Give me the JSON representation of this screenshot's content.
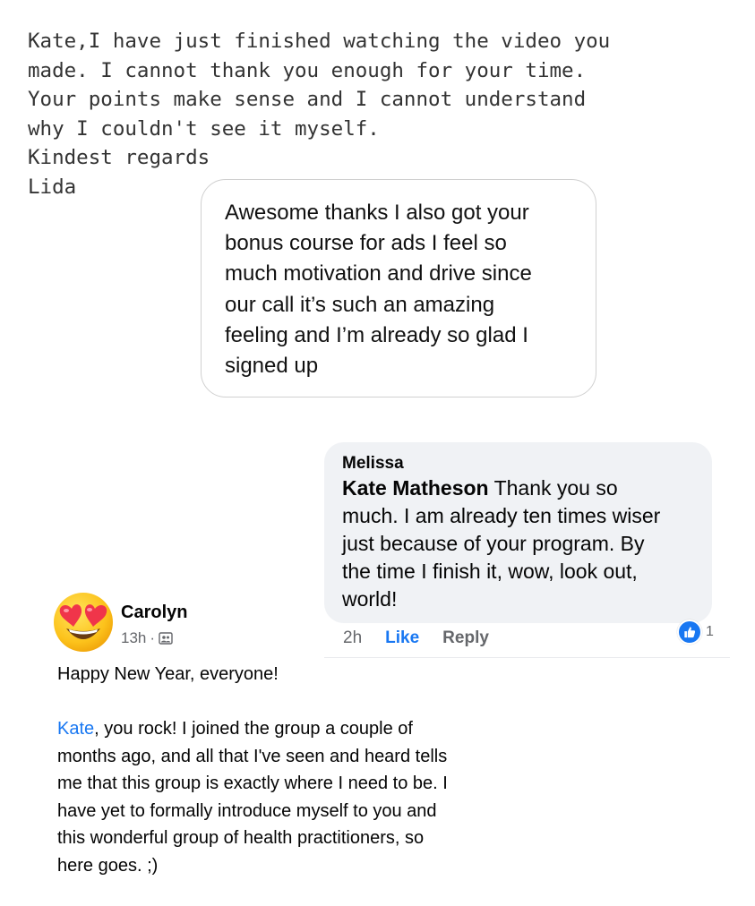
{
  "email": {
    "lines": [
      "Kate,I have just finished watching the video you",
      "made. I cannot thank you enough for your time.",
      "Your points make sense and I cannot understand",
      "why I couldn't see it myself.",
      "Kindest regards",
      "Lida"
    ]
  },
  "bubble": {
    "lines": [
      "Awesome thanks I also got your",
      "bonus course for ads I feel so",
      "much motivation and drive since",
      "our call it’s such an amazing",
      "feeling and I’m already so glad I",
      "signed up"
    ]
  },
  "fb_reply": {
    "author": "Melissa",
    "mention": "Kate Matheson",
    "first_line_rest": " Thank you so",
    "lines": [
      "much. I am already ten times wiser",
      "just because of your program. By",
      "the time I finish it, wow, look out,",
      "world!"
    ],
    "time": "2h",
    "like_label": "Like",
    "reply_label": "Reply",
    "reaction_count": "1"
  },
  "post": {
    "author": "Carolyn",
    "time": "13h",
    "dot": "·",
    "greeting": "Happy New Year, everyone!",
    "mention": "Kate",
    "first_line_rest": ", you rock! I joined the group a couple of",
    "lines": [
      "months ago, and all that I've seen and heard tells",
      "me that this group is exactly where I need to be. I",
      "have yet to formally introduce myself to you and",
      "this wonderful group of health practitioners, so",
      "here goes. ;)"
    ]
  },
  "colors": {
    "link_blue": "#1877f2",
    "comment_bg": "#f0f2f5",
    "secondary_text": "#65676b"
  },
  "icons": {
    "avatar": "heart-eyes-emoji-icon",
    "reaction": "thumbs-up-icon",
    "privacy": "group-icon"
  }
}
